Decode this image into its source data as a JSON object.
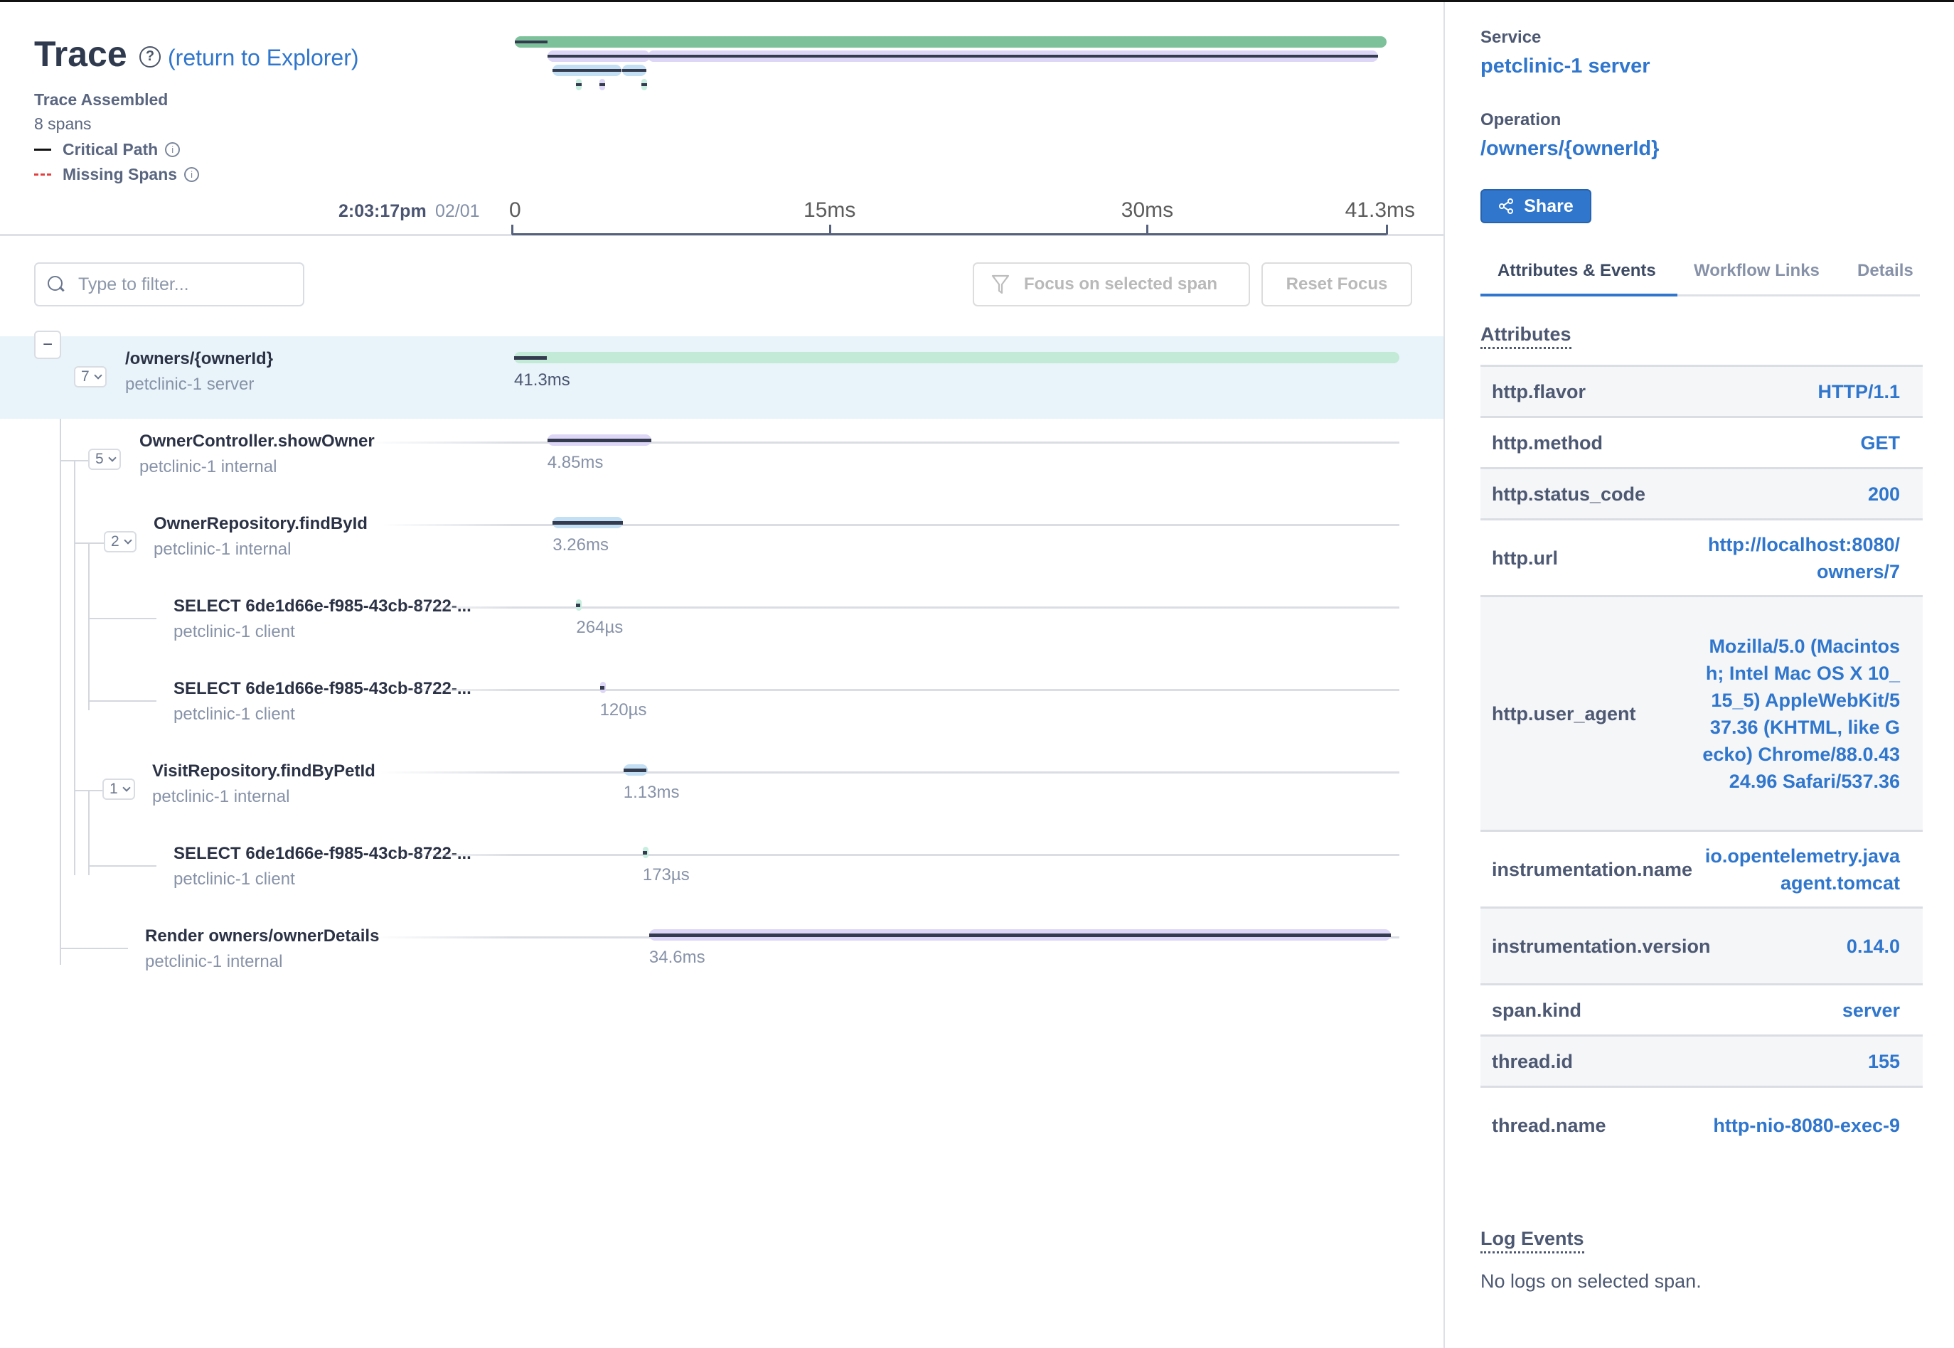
{
  "header": {
    "title": "Trace",
    "return_link": "(return to Explorer)",
    "status": "Trace Assembled",
    "span_count": "8 spans",
    "legend": {
      "critical_path": "Critical Path",
      "missing_spans": "Missing Spans"
    }
  },
  "timeline": {
    "start_time": "2:03:17pm",
    "start_date": "02/01",
    "total_ms": 41.3,
    "ticks": [
      {
        "label": "0",
        "ms": 0
      },
      {
        "label": "15ms",
        "ms": 15
      },
      {
        "label": "30ms",
        "ms": 30
      },
      {
        "label": "41.3ms",
        "ms": 41.3
      }
    ]
  },
  "toolbar": {
    "filter_placeholder": "Type to filter...",
    "filter_value": "",
    "focus_button": "Focus on selected span",
    "reset_button": "Reset Focus"
  },
  "colors": {
    "server": "#c3ead6",
    "server_minimap": "#7dc19a",
    "internal_purple": "#ddd6f6",
    "internal_blue": "#c3dff3",
    "client_green": "#c7eede",
    "client_purple": "#ddd6f6",
    "critical": "#353b4f",
    "accent": "#2f76cc",
    "selected_row": "#e9f4fa"
  },
  "spans": [
    {
      "name": "/owners/{ownerId}",
      "service": "petclinic-1 server",
      "duration": "41.3ms",
      "start_ms": 0,
      "dur_ms": 41.3,
      "depth": 0,
      "children": "7",
      "color": "server",
      "selected": true
    },
    {
      "name": "OwnerController.showOwner",
      "service": "petclinic-1 internal",
      "duration": "4.85ms",
      "start_ms": 1.55,
      "dur_ms": 4.85,
      "depth": 1,
      "children": "5",
      "color": "internal_purple"
    },
    {
      "name": "OwnerRepository.findById",
      "service": "petclinic-1 internal",
      "duration": "3.26ms",
      "start_ms": 1.8,
      "dur_ms": 3.26,
      "depth": 2,
      "children": "2",
      "color": "internal_blue"
    },
    {
      "name": "SELECT 6de1d66e-f985-43cb-8722-...",
      "service": "petclinic-1 client",
      "duration": "264µs",
      "start_ms": 2.9,
      "dur_ms": 0.264,
      "depth": 3,
      "children": null,
      "color": "client_green"
    },
    {
      "name": "SELECT 6de1d66e-f985-43cb-8722-...",
      "service": "petclinic-1 client",
      "duration": "120µs",
      "start_ms": 4.0,
      "dur_ms": 0.12,
      "depth": 3,
      "children": null,
      "color": "client_purple"
    },
    {
      "name": "VisitRepository.findByPetId",
      "service": "petclinic-1 internal",
      "duration": "1.13ms",
      "start_ms": 5.1,
      "dur_ms": 1.13,
      "depth": 2,
      "children": "1",
      "color": "internal_blue"
    },
    {
      "name": "SELECT 6de1d66e-f985-43cb-8722-...",
      "service": "petclinic-1 client",
      "duration": "173µs",
      "start_ms": 6.0,
      "dur_ms": 0.173,
      "depth": 3,
      "children": null,
      "color": "client_green"
    },
    {
      "name": "Render owners/ownerDetails",
      "service": "petclinic-1 internal",
      "duration": "34.6ms",
      "start_ms": 6.3,
      "dur_ms": 34.6,
      "depth": 1,
      "children": null,
      "color": "internal_purple"
    }
  ],
  "details": {
    "service_label": "Service",
    "service_value": "petclinic-1 server",
    "operation_label": "Operation",
    "operation_value": "/owners/{ownerId}",
    "share_button": "Share",
    "tabs": [
      {
        "label": "Attributes & Events",
        "active": true
      },
      {
        "label": "Workflow Links",
        "active": false
      },
      {
        "label": "Details",
        "active": false
      }
    ],
    "attributes_title": "Attributes",
    "attributes": [
      {
        "key": "http.flavor",
        "value": "HTTP/1.1"
      },
      {
        "key": "http.method",
        "value": "GET"
      },
      {
        "key": "http.status_code",
        "value": "200"
      },
      {
        "key": "http.url",
        "value": "http://localhost:8080/owners/7"
      },
      {
        "key": "http.user_agent",
        "value": "Mozilla/5.0 (Macintosh; Intel Mac OS X 10_15_5) AppleWebKit/537.36 (KHTML, like Gecko) Chrome/88.0.4324.96 Safari/537.36"
      },
      {
        "key": "instrumentation.name",
        "value": "io.opentelemetry.javaagent.tomcat"
      },
      {
        "key": "instrumentation.version",
        "value": "0.14.0"
      },
      {
        "key": "span.kind",
        "value": "server"
      },
      {
        "key": "thread.id",
        "value": "155"
      },
      {
        "key": "thread.name",
        "value": "http-nio-8080-exec-9"
      }
    ],
    "log_events_title": "Log Events",
    "no_logs": "No logs on selected span."
  }
}
